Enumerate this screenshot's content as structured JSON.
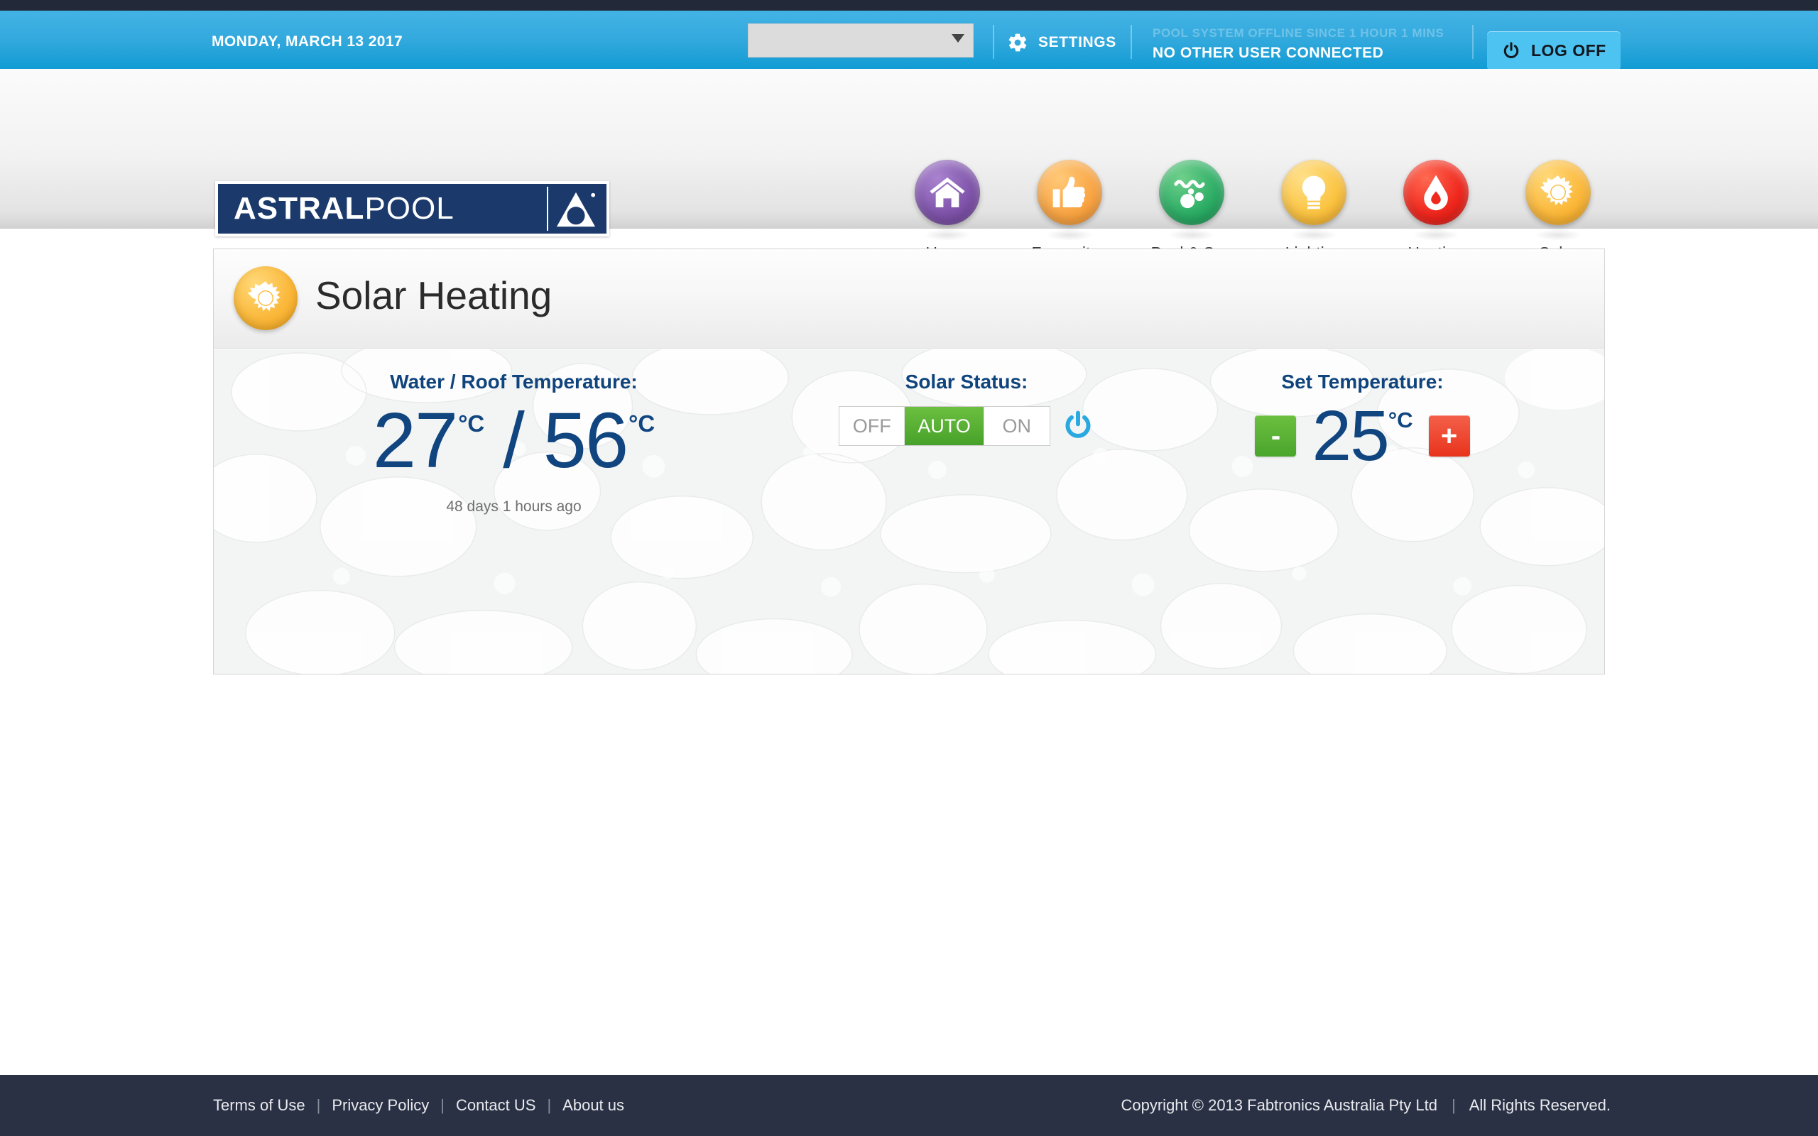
{
  "utility_bar": {
    "date": "MONDAY, MARCH 13 2017",
    "site_select_value": "",
    "site_select_placeholder": "",
    "settings_label": "SETTINGS",
    "settings_icon": "gear-icon",
    "offline_notice": "POOL SYSTEM OFFLINE SINCE 1 HOUR 1 MINS",
    "connection_status": "NO OTHER USER CONNECTED",
    "logoff_label": "LOG OFF",
    "logoff_icon": "power-icon",
    "bar_color": "#35aade",
    "logoff_color": "#4cc3f0"
  },
  "brand": {
    "logo_bold": "ASTRAL",
    "logo_light": "POOL",
    "logo_mark": "triangle-droplet-icon",
    "logo_color": "#1b3a6b"
  },
  "nav": {
    "items": [
      {
        "label": "Home",
        "icon": "house-icon",
        "color": "#8055ab"
      },
      {
        "label": "Favourites",
        "icon": "thumbs-up-icon",
        "color": "#f9a646"
      },
      {
        "label": "Pool & Spa",
        "icon": "pool-bubbles-icon",
        "color": "#2fae67"
      },
      {
        "label": "Lighting",
        "icon": "lightbulb-icon",
        "color": "#fbc544"
      },
      {
        "label": "Heating",
        "icon": "flame-drop-icon",
        "color": "#f0291f"
      },
      {
        "label": "Solar",
        "icon": "sun-icon",
        "color": "#fbb93c"
      }
    ]
  },
  "panel": {
    "title": "Solar Heating",
    "icon": "sun-icon",
    "water_roof": {
      "label": "Water / Roof Temperature:",
      "water_value": "27",
      "water_unit": "°C",
      "separator": "/",
      "roof_value": "56",
      "roof_unit": "°C",
      "updated_ago": "48 days 1 hours ago",
      "value_color": "#10457f"
    },
    "solar_status": {
      "label": "Solar Status:",
      "options": [
        "OFF",
        "AUTO",
        "ON"
      ],
      "selected": "AUTO",
      "active_color": "#47a22a",
      "power_icon": "power-icon",
      "power_icon_color": "#2aa9e0"
    },
    "set_temperature": {
      "label": "Set Temperature:",
      "decrement_label": "-",
      "increment_label": "+",
      "value": "25",
      "unit": "°C",
      "decrement_color": "#4aa52c",
      "increment_color": "#e8331c"
    }
  },
  "footer": {
    "links": [
      "Terms of Use",
      "Privacy Policy",
      "Contact US",
      "About us"
    ],
    "separator": "|",
    "copyright": "Copyright © 2013 Fabtronics Australia Pty Ltd",
    "rights": "All Rights Reserved."
  }
}
